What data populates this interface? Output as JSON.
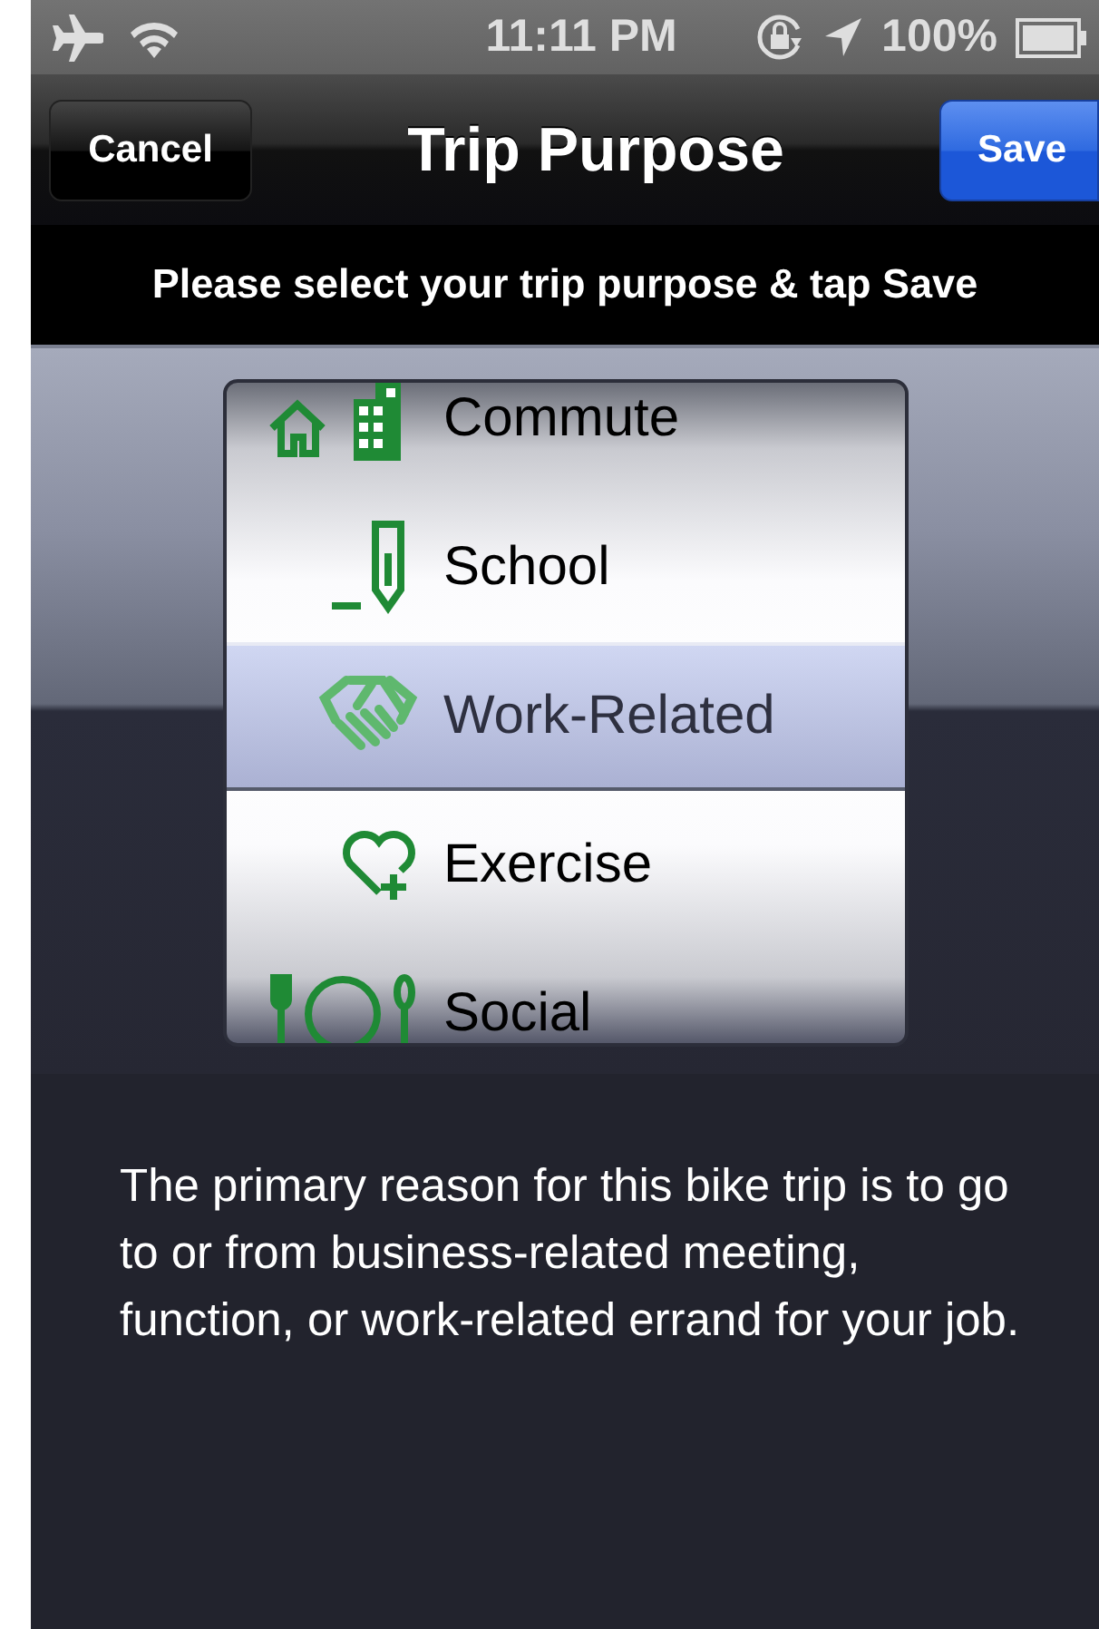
{
  "status_bar": {
    "time": "11:11 PM",
    "battery": "100%"
  },
  "nav_bar": {
    "cancel": "Cancel",
    "title": "Trip Purpose",
    "save": "Save"
  },
  "prompt": "Please select your trip purpose & tap Save",
  "picker": {
    "items": [
      {
        "label": "Commute",
        "kind": "house",
        "selected": false
      },
      {
        "label": "School",
        "kind": "pencil",
        "selected": false
      },
      {
        "label": "Work-Related",
        "kind": "handshake",
        "selected": true
      },
      {
        "label": "Exercise",
        "kind": "heart",
        "selected": false
      },
      {
        "label": "Social",
        "kind": "dining",
        "selected": false
      }
    ]
  },
  "description": "The primary reason for this bike trip is to go to or from business-related meeting, function, or work-related errand for your job."
}
